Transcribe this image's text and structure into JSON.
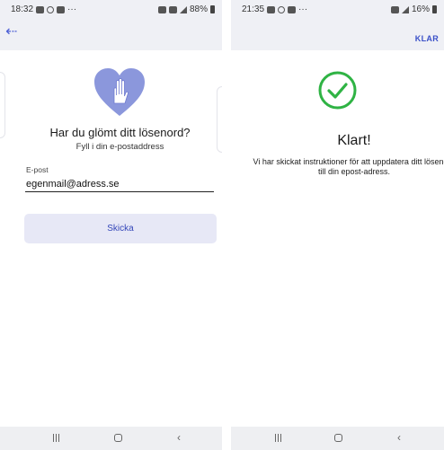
{
  "left_screen": {
    "status_bar": {
      "time": "18:32",
      "dots": "···",
      "battery": "88%"
    },
    "back_icon": "arrow-left-icon",
    "illustration": "heart-hand-icon",
    "title": "Har du glömt ditt lösenord?",
    "subtitle": "Fyll i din e-postaddress",
    "email": {
      "label": "E-post",
      "value": "egenmail@adress.se"
    },
    "submit_label": "Skicka"
  },
  "right_screen": {
    "status_bar": {
      "time": "21:35",
      "dots": "···",
      "battery": "16%"
    },
    "done_label": "KLAR",
    "illustration": "check-circle-icon",
    "title": "Klart!",
    "message": "Vi har skickat instruktioner för att uppdatera ditt lösenord till din epost-adress."
  },
  "colors": {
    "accent": "#4c5fd5",
    "heart": "#8b97dc",
    "check": "#2fb344",
    "button_bg": "#e7e8f6",
    "bar_bg": "#eff0f5"
  }
}
